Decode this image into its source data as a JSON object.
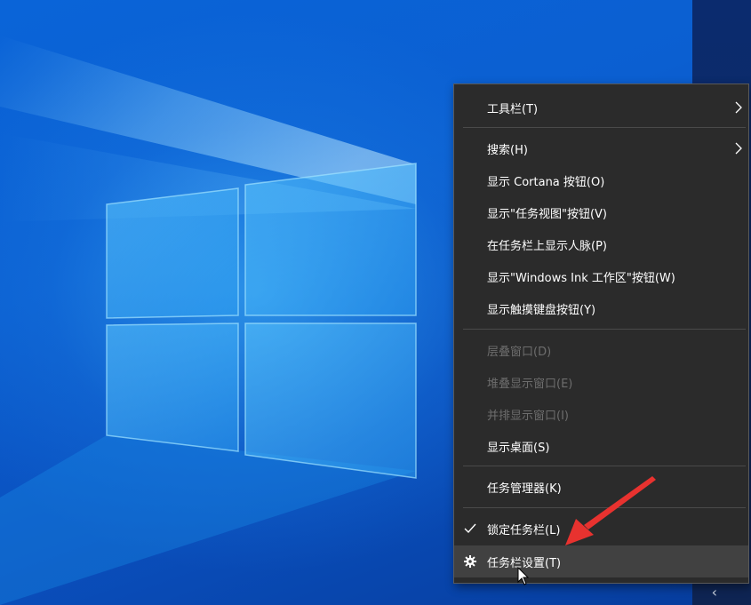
{
  "desktop": {
    "wallpaper": "windows-10-hero",
    "colors": {
      "bg": "#0a5fd1",
      "menu_bg": "#2b2b2b",
      "menu_text": "#ffffff",
      "disabled_text": "#6d6d6d",
      "annotation": "#e8322f"
    }
  },
  "taskbar": {
    "tray_chevron": "‹"
  },
  "context_menu": {
    "items": [
      {
        "label": "工具栏(T)",
        "submenu": true,
        "enabled": true
      },
      {
        "label": "搜索(H)",
        "submenu": true,
        "enabled": true
      },
      {
        "label": "显示 Cortana 按钮(O)",
        "enabled": true
      },
      {
        "label": "显示\"任务视图\"按钮(V)",
        "enabled": true
      },
      {
        "label": "在任务栏上显示人脉(P)",
        "enabled": true
      },
      {
        "label": "显示\"Windows Ink 工作区\"按钮(W)",
        "enabled": true
      },
      {
        "label": "显示触摸键盘按钮(Y)",
        "enabled": true
      },
      {
        "label": "层叠窗口(D)",
        "enabled": false
      },
      {
        "label": "堆叠显示窗口(E)",
        "enabled": false
      },
      {
        "label": "并排显示窗口(I)",
        "enabled": false
      },
      {
        "label": "显示桌面(S)",
        "enabled": true
      },
      {
        "label": "任务管理器(K)",
        "enabled": true
      },
      {
        "label": "锁定任务栏(L)",
        "enabled": true,
        "checked": true,
        "icon": "checkmark-icon"
      },
      {
        "label": "任务栏设置(T)",
        "enabled": true,
        "highlighted": true,
        "icon": "gear-icon"
      }
    ]
  }
}
